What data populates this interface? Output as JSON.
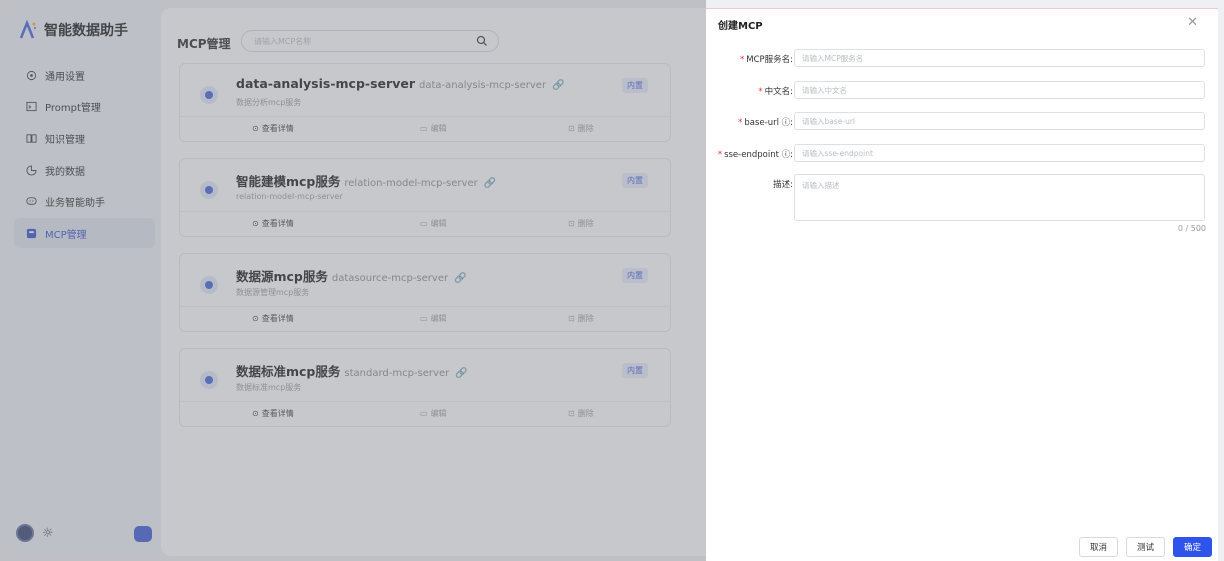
{
  "app": {
    "title": "智能数据助手"
  },
  "sidebar": {
    "items": [
      {
        "label": "通用设置",
        "icon": "settings-icon"
      },
      {
        "label": "Prompt管理",
        "icon": "prompt-icon"
      },
      {
        "label": "知识管理",
        "icon": "book-icon"
      },
      {
        "label": "我的数据",
        "icon": "pie-chart-icon"
      },
      {
        "label": "业务智能助手",
        "icon": "chat-icon"
      },
      {
        "label": "MCP管理",
        "icon": "mcp-icon",
        "active": true
      }
    ]
  },
  "main": {
    "title": "MCP管理",
    "search_placeholder": "请输入MCP名称",
    "cards": [
      {
        "name": "data-analysis-mcp-server",
        "en": "data-analysis-mcp-server",
        "desc": "数据分析mcp服务",
        "tag": "内置"
      },
      {
        "name": "智能建模mcp服务",
        "en": "relation-model-mcp-server",
        "desc": "relation-model-mcp-server",
        "tag": "内置"
      },
      {
        "name": "数据源mcp服务",
        "en": "datasource-mcp-server",
        "desc": "数据源管理mcp服务",
        "tag": "内置"
      },
      {
        "name": "数据标准mcp服务",
        "en": "standard-mcp-server",
        "desc": "数据标准mcp服务",
        "tag": "内置"
      }
    ],
    "actions": {
      "view": "查看详情",
      "edit": "编辑",
      "delete": "删除"
    }
  },
  "drawer": {
    "title": "创建MCP",
    "fields": {
      "name": {
        "label": "MCP服务名:",
        "placeholder": "请输入MCP服务名"
      },
      "cn_name": {
        "label": "中文名:",
        "placeholder": "请输入中文名"
      },
      "base_url": {
        "label": "base-url ⓘ:",
        "placeholder": "请输入base-url"
      },
      "sse_endpoint": {
        "label": "sse-endpoint ⓘ:",
        "placeholder": "请输入sse-endpoint"
      },
      "description": {
        "label": "描述:",
        "placeholder": "请输入描述"
      }
    },
    "counter": "0 / 500",
    "buttons": {
      "cancel": "取消",
      "test": "测试",
      "confirm": "确定"
    }
  },
  "colors": {
    "accent": "#2f54eb",
    "required": "#e53935",
    "tag_bg": "#e7ecfd"
  }
}
